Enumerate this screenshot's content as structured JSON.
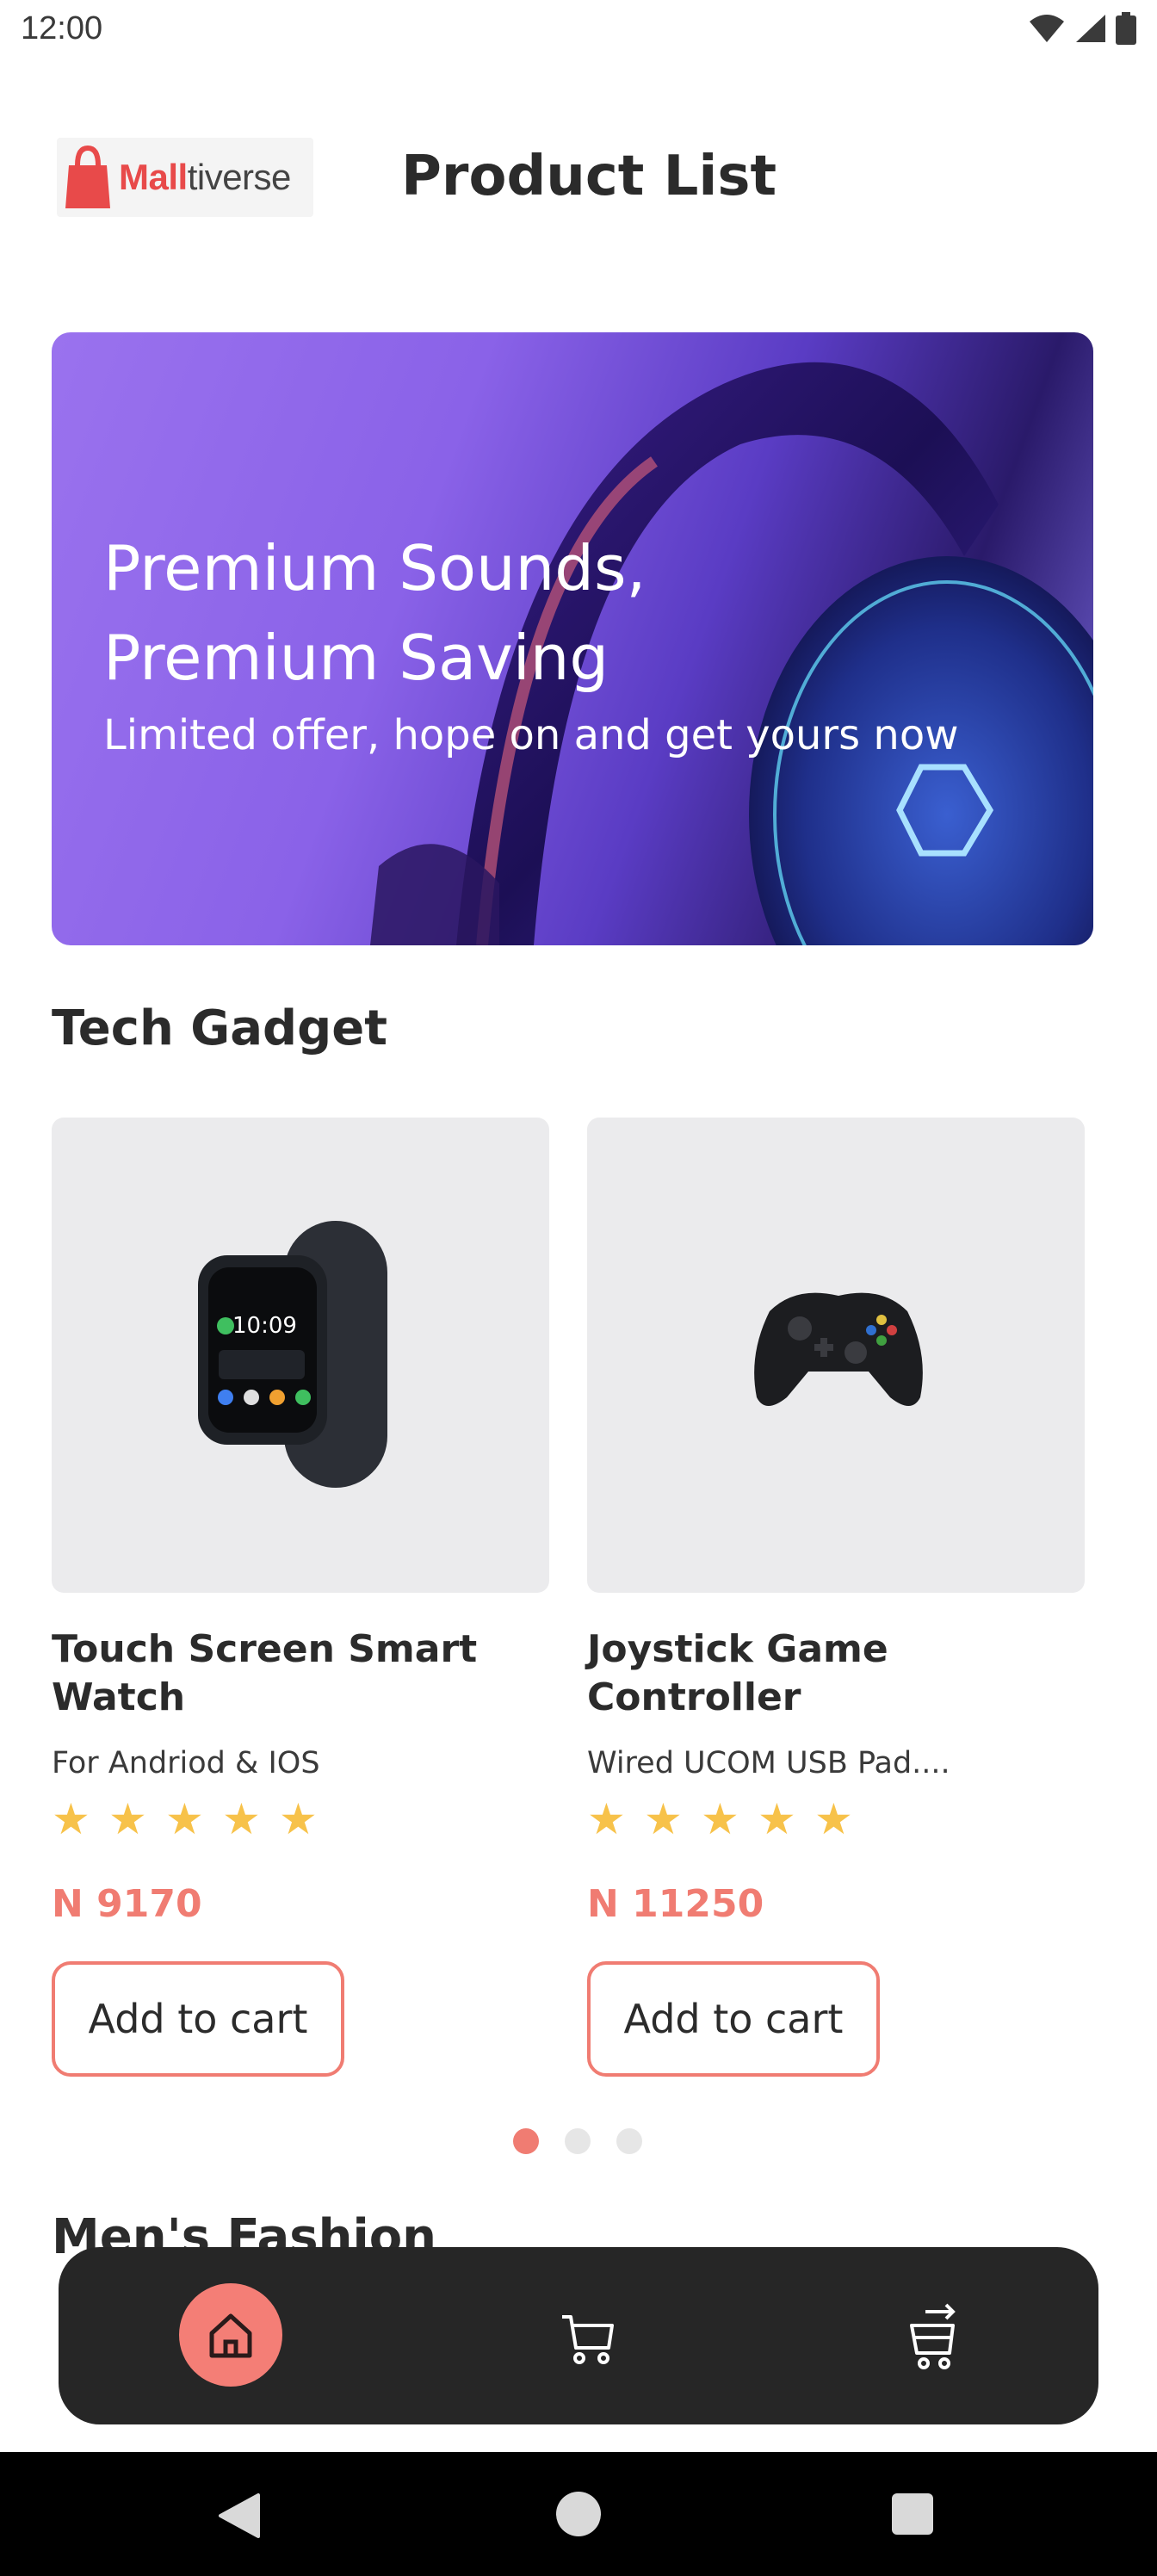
{
  "status_bar": {
    "time": "12:00"
  },
  "header": {
    "logo_part1": "Mall",
    "logo_part2": "tiverse",
    "title": "Product List"
  },
  "banner": {
    "title": "Premium Sounds, Premium Saving",
    "subtitle": "Limited offer, hope on and get yours now"
  },
  "section": {
    "title": "Tech Gadget"
  },
  "products": [
    {
      "name": "Touch Screen Smart Watch",
      "description": "For Andriod & IOS",
      "rating": 5,
      "stars": "★★★★★",
      "price": "N 9170",
      "button_label": "Add to cart"
    },
    {
      "name": "Joystick Game Controller",
      "description": "Wired UCOM USB Pad....",
      "rating": 5,
      "stars": "★★★★★",
      "price": "N 11250",
      "button_label": "Add to cart"
    }
  ],
  "pager": {
    "count": 3,
    "active_index": 0
  },
  "section2": {
    "title": "Men's Fashion"
  },
  "bottom_nav": {
    "items": [
      {
        "icon": "home-icon",
        "active": true
      },
      {
        "icon": "cart-icon",
        "active": false
      },
      {
        "icon": "checkout-icon",
        "active": false
      }
    ]
  },
  "colors": {
    "accent": "#f07c72",
    "star": "#f7c24a",
    "nav_background": "#262626",
    "card_background": "#ebebed"
  }
}
